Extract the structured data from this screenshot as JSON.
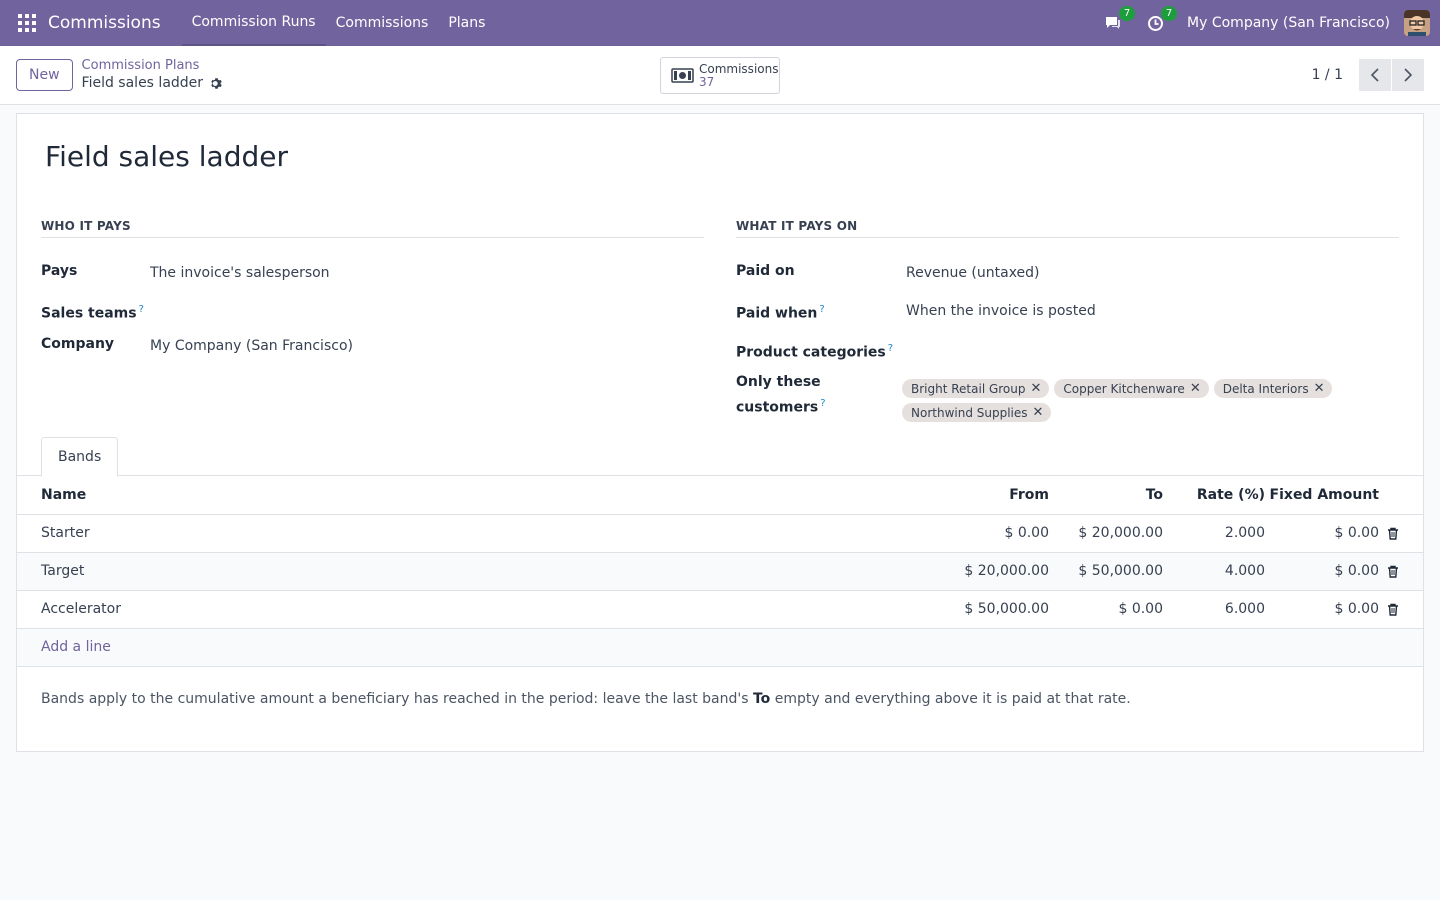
{
  "navbar": {
    "brand": "Commissions",
    "menu": [
      "Commission Runs",
      "Commissions",
      "Plans"
    ],
    "messages_count": "7",
    "activities_count": "7",
    "company": "My Company (San Francisco)"
  },
  "control_panel": {
    "new_label": "New",
    "breadcrumb_parent": "Commission Plans",
    "breadcrumb_current": "Field sales ladder",
    "smart_button_label": "Commissions",
    "smart_button_value": "37",
    "pager": "1 / 1"
  },
  "form": {
    "title": "Field sales ladder",
    "who_header": "WHO IT PAYS",
    "what_header": "WHAT IT PAYS ON",
    "pays_label": "Pays",
    "pays_value": "The invoice's salesperson",
    "sales_teams_label": "Sales teams",
    "company_label": "Company",
    "company_value": "My Company (San Francisco)",
    "paid_on_label": "Paid on",
    "paid_on_value": "Revenue (untaxed)",
    "paid_when_label": "Paid when",
    "paid_when_value": "When the invoice is posted",
    "product_categories_label": "Product categories",
    "only_customers_label_1": "Only these",
    "only_customers_label_2": "customers",
    "help_mark": "?",
    "customers": [
      "Bright Retail Group",
      "Copper Kitchenware",
      "Delta Interiors",
      "Northwind Supplies"
    ],
    "tag_remove": "✕"
  },
  "tabs": [
    "Bands"
  ],
  "bands": {
    "headers": [
      "Name",
      "From",
      "To",
      "Rate (%)",
      "Fixed Amount"
    ],
    "rows": [
      {
        "name": "Starter",
        "from": "$ 0.00",
        "to": "$ 20,000.00",
        "rate": "2.000",
        "fixed": "$ 0.00"
      },
      {
        "name": "Target",
        "from": "$ 20,000.00",
        "to": "$ 50,000.00",
        "rate": "4.000",
        "fixed": "$ 0.00"
      },
      {
        "name": "Accelerator",
        "from": "$ 50,000.00",
        "to": "$ 0.00",
        "rate": "6.000",
        "fixed": "$ 0.00"
      }
    ],
    "add_line": "Add a line"
  },
  "note": {
    "before": "Bands apply to the cumulative amount a beneficiary has reached in the period: leave the last band's ",
    "bold": "To",
    "after": " empty and everything above it is paid at that rate."
  }
}
